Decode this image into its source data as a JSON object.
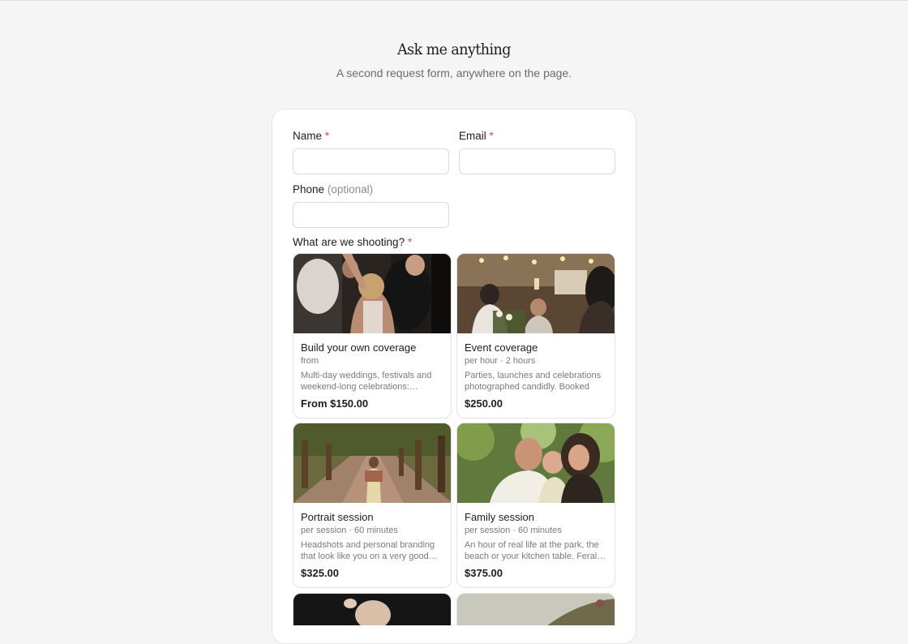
{
  "header": {
    "title": "Ask me anything",
    "subtitle": "A second request form, anywhere on the page."
  },
  "form": {
    "name": {
      "label": "Name",
      "required_mark": "*",
      "value": ""
    },
    "email": {
      "label": "Email",
      "required_mark": "*",
      "value": ""
    },
    "phone": {
      "label": "Phone",
      "optional_note": "(optional)",
      "value": ""
    },
    "shooting": {
      "label": "What are we shooting?",
      "required_mark": "*"
    }
  },
  "services": [
    {
      "name": "Build your own coverage",
      "meta": "from",
      "description": "Multi-day weddings, festivals and weekend-long celebrations:…",
      "price": "From $150.00"
    },
    {
      "name": "Event coverage",
      "meta": "per hour · 2 hours",
      "description": "Parties, launches and celebrations photographed candidly. Booked by…",
      "price": "$250.00"
    },
    {
      "name": "Portrait session",
      "meta": "per session · 60 minutes",
      "description": "Headshots and personal branding that look like you on a very good…",
      "price": "$325.00"
    },
    {
      "name": "Family session",
      "meta": "per session · 60 minutes",
      "description": "An hour of real life at the park, the beach or your kitchen table. Feral…",
      "price": "$375.00"
    }
  ],
  "colors": {
    "background": "#f5f5f5",
    "card": "#ffffff",
    "required": "#e5484d",
    "muted_text": "#7a7a7a"
  }
}
